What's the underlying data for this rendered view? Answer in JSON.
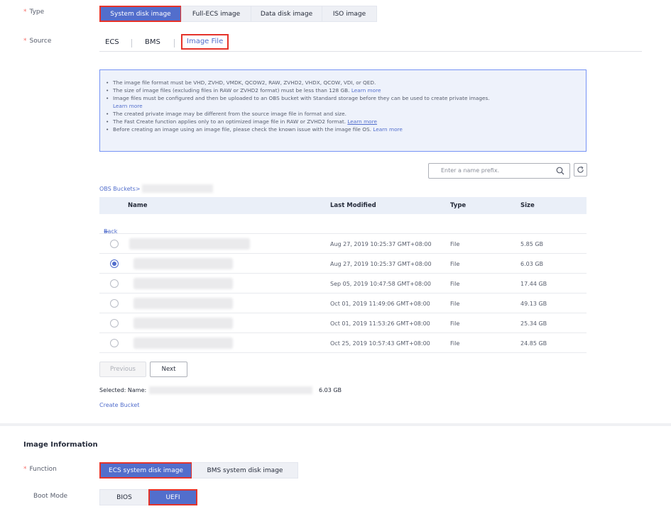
{
  "type_field": {
    "label": "Type",
    "options": [
      "System disk image",
      "Full-ECS image",
      "Data disk image",
      "ISO image"
    ],
    "selected": "System disk image"
  },
  "source_field": {
    "label": "Source",
    "tabs": [
      "ECS",
      "BMS",
      "Image File"
    ],
    "selected": "Image File"
  },
  "notice": {
    "items": [
      {
        "text": "The image file format must be VHD, ZVHD, VMDK, QCOW2, RAW, ZVHD2, VHDX, QCOW, VDI, or QED."
      },
      {
        "text": "The size of image files (excluding files in RAW or ZVHD2 format) must be less than 128 GB.",
        "link": "Learn more"
      },
      {
        "text": "Image files must be configured and then be uploaded to an OBS bucket with Standard storage before they can be used to create private images.",
        "link": "Learn more"
      },
      {
        "text": "The created private image may be different from the source image file in format and size."
      },
      {
        "text": "The Fast Create function applies only to an optimized image file in RAW or ZVHD2 format.",
        "link": "Learn more",
        "link_underline": true
      },
      {
        "text": "Before creating an image using an image file, please check the known issue with the image file OS.",
        "link": "Learn more"
      }
    ]
  },
  "search": {
    "placeholder": "Enter a name prefix.",
    "icon": "search-icon"
  },
  "refresh": {
    "icon": "refresh-icon"
  },
  "breadcrumb": {
    "root": "OBS Buckets>"
  },
  "table": {
    "headers": {
      "name": "Name",
      "last_modified": "Last Modified",
      "type": "Type",
      "size": "Size"
    },
    "back_label": "Back",
    "rows": [
      {
        "modified": "Aug 27, 2019 10:25:37 GMT+08:00",
        "type": "File",
        "size": "5.85 GB",
        "selected": false
      },
      {
        "modified": "Aug 27, 2019 10:25:37 GMT+08:00",
        "type": "File",
        "size": "6.03 GB",
        "selected": true
      },
      {
        "modified": "Sep 05, 2019 10:47:58 GMT+08:00",
        "type": "File",
        "size": "17.44 GB",
        "selected": false
      },
      {
        "modified": "Oct 01, 2019 11:49:06 GMT+08:00",
        "type": "File",
        "size": "49.13 GB",
        "selected": false
      },
      {
        "modified": "Oct 01, 2019 11:53:26 GMT+08:00",
        "type": "File",
        "size": "25.34 GB",
        "selected": false
      },
      {
        "modified": "Oct 25, 2019 10:57:43 GMT+08:00",
        "type": "File",
        "size": "24.85 GB",
        "selected": false
      }
    ]
  },
  "pagination": {
    "previous": "Previous",
    "next": "Next"
  },
  "selected_info": {
    "label": "Selected: Name:",
    "size": "6.03 GB"
  },
  "create_bucket": "Create Bucket",
  "image_info": {
    "heading": "Image Information",
    "function": {
      "label": "Function",
      "options": [
        "ECS system disk image",
        "BMS system disk image"
      ],
      "selected": "ECS system disk image"
    },
    "boot_mode": {
      "label": "Boot Mode",
      "options": [
        "BIOS",
        "UEFI"
      ],
      "selected": "UEFI"
    }
  },
  "colors": {
    "accent": "#526ecc",
    "required": "#f66f6a",
    "highlight_box": "#e5332a"
  }
}
